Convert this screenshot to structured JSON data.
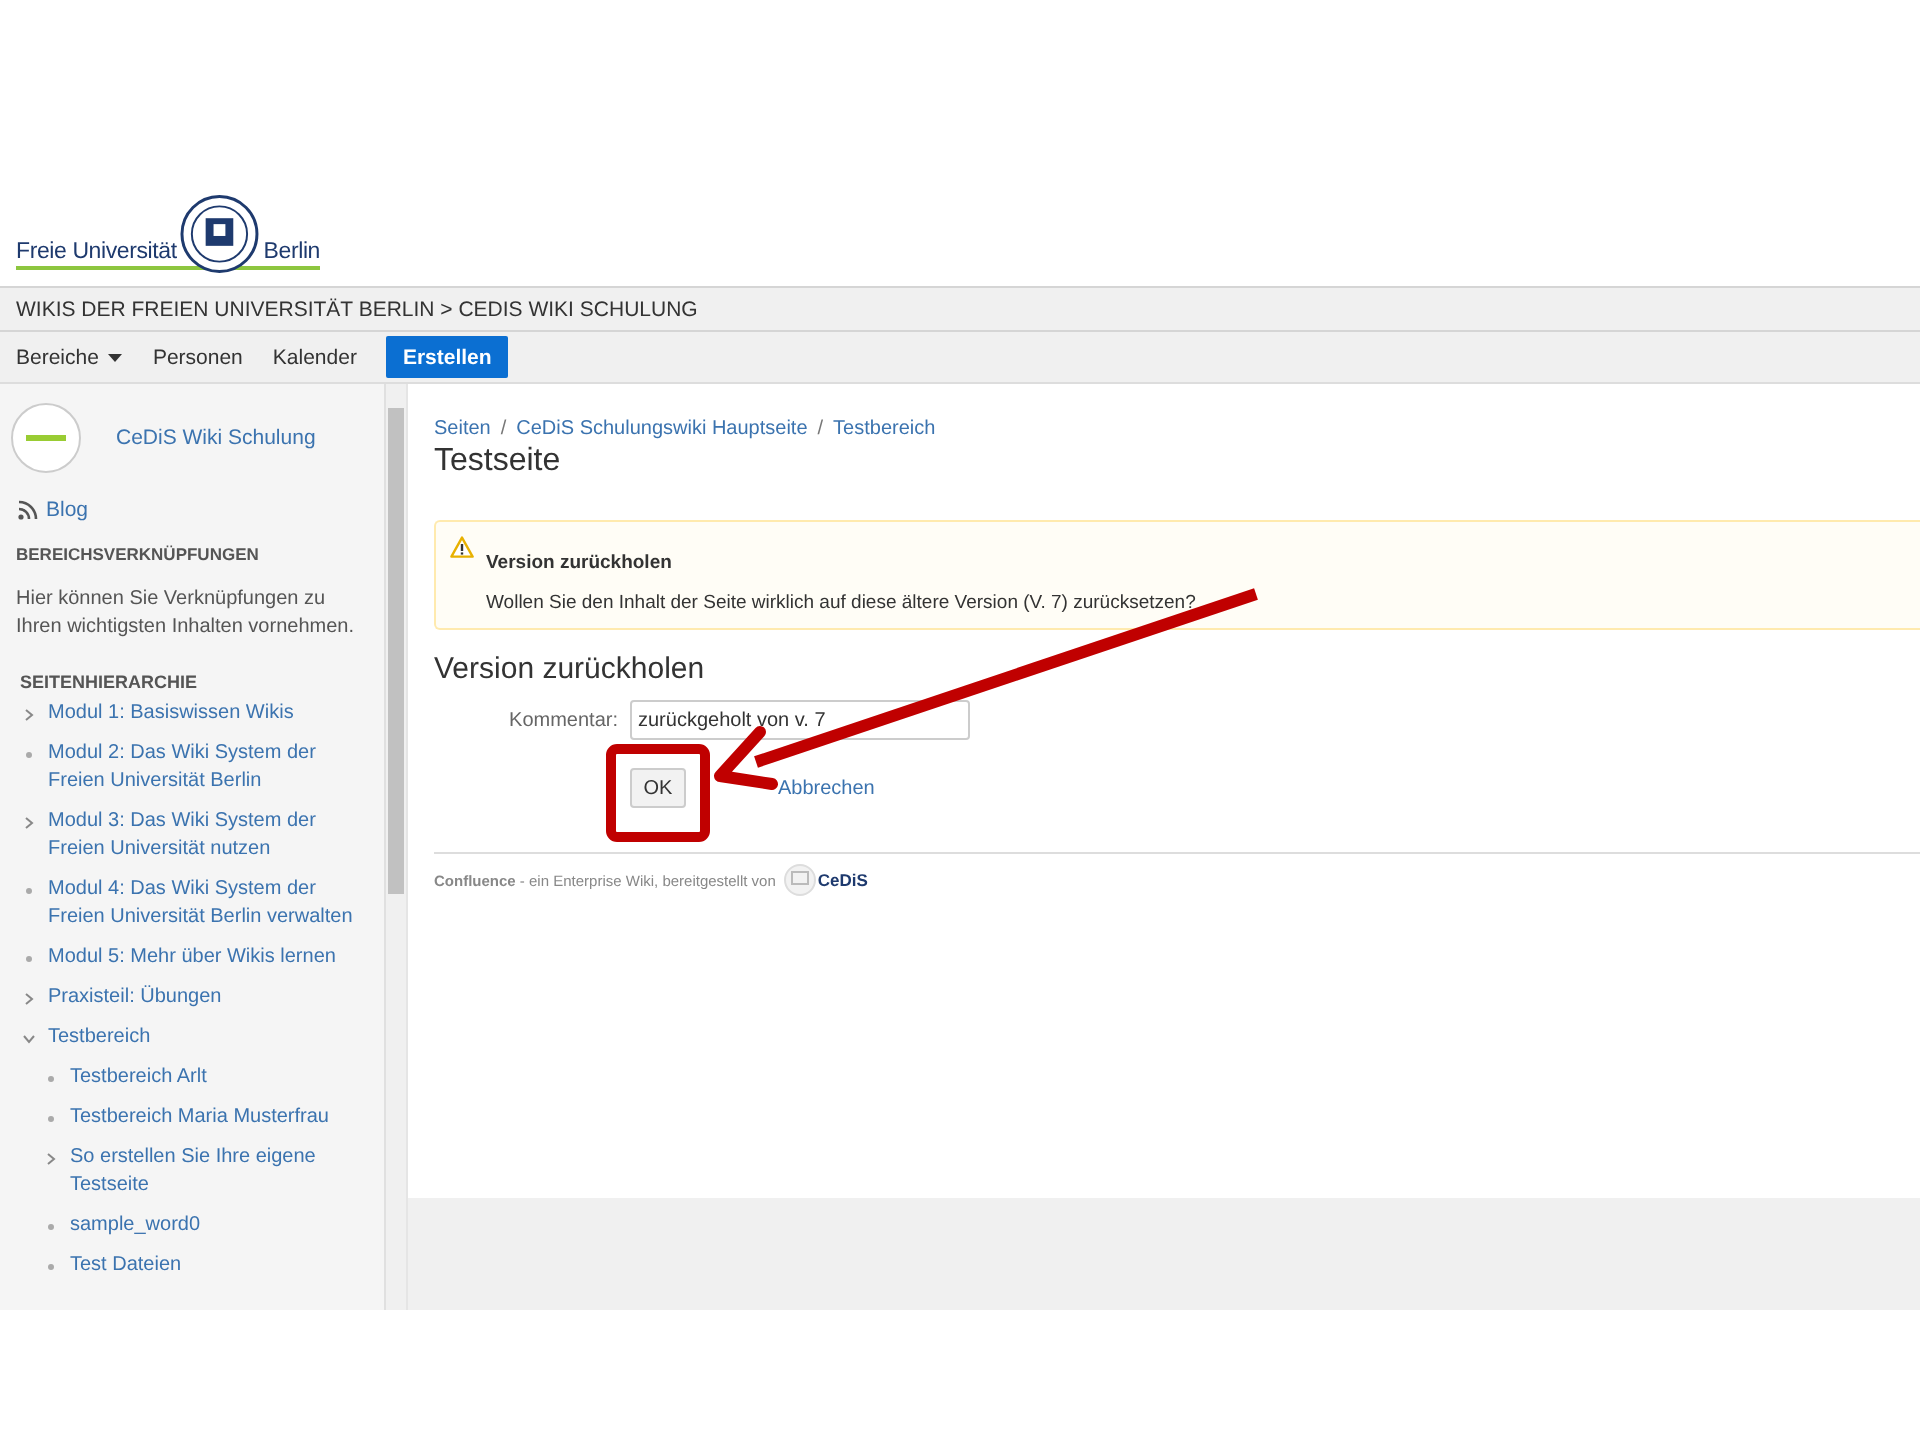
{
  "logo": {
    "left": "Freie Universität",
    "right": "Berlin"
  },
  "breadcrumb_bar": "WIKIS DER FREIEN UNIVERSITÄT BERLIN > CEDIS WIKI SCHULUNG",
  "nav": [
    {
      "label": "Bereiche",
      "kind": "dropdown"
    },
    {
      "label": "Personen",
      "kind": "link"
    },
    {
      "label": "Kalender",
      "kind": "link"
    },
    {
      "label": "Erstellen",
      "kind": "primary"
    }
  ],
  "sidebar": {
    "space_name": "CeDiS Wiki Schulung",
    "blog": "Blog",
    "shortcuts_heading": "BEREICHSVERKNÜPFUNGEN",
    "shortcuts_text": "Hier können Sie Verknüpfungen zu Ihren wichtigsten Inhalten vornehmen.",
    "tree_heading": "SEITENHIERARCHIE",
    "tree": [
      {
        "label": "Modul 1: Basiswissen Wikis",
        "kind": "branch",
        "expanded": false
      },
      {
        "label": "Modul 2: Das Wiki System der Freien Universität Berlin",
        "kind": "leaf"
      },
      {
        "label": "Modul 3: Das Wiki System der Freien Universität nutzen",
        "kind": "branch",
        "expanded": false
      },
      {
        "label": "Modul 4: Das Wiki System der Freien Universität Berlin verwalten",
        "kind": "leaf"
      },
      {
        "label": "Modul 5: Mehr über Wikis lernen",
        "kind": "leaf"
      },
      {
        "label": "Praxisteil: Übungen",
        "kind": "branch",
        "expanded": false
      },
      {
        "label": "Testbereich",
        "kind": "branch",
        "expanded": true,
        "children": [
          {
            "label": "Testbereich Arlt",
            "kind": "leaf"
          },
          {
            "label": "Testbereich Maria Musterfrau",
            "kind": "leaf"
          },
          {
            "label": "So erstellen Sie Ihre eigene Testseite",
            "kind": "branch",
            "expanded": false
          },
          {
            "label": "sample_word0",
            "kind": "leaf"
          },
          {
            "label": "Test Dateien",
            "kind": "leaf"
          }
        ]
      }
    ]
  },
  "breadcrumbs": [
    "Seiten",
    "CeDiS Schulungswiki Hauptseite",
    "Testbereich"
  ],
  "breadcrumb_separator": "/",
  "page_title": "Testseite",
  "warning": {
    "title": "Version zurückholen",
    "text": "Wollen Sie den Inhalt der Seite wirklich auf diese ältere Version (V. 7) zurücksetzen?"
  },
  "form": {
    "heading": "Version zurückholen",
    "comment_label": "Kommentar:",
    "comment_value": "zurückgeholt von v. 7",
    "ok": "OK",
    "cancel": "Abbrechen"
  },
  "footer": {
    "text": "**Confluence** - ein Enterprise Wiki, bereitgestellt von",
    "brand": "CeDiS"
  }
}
